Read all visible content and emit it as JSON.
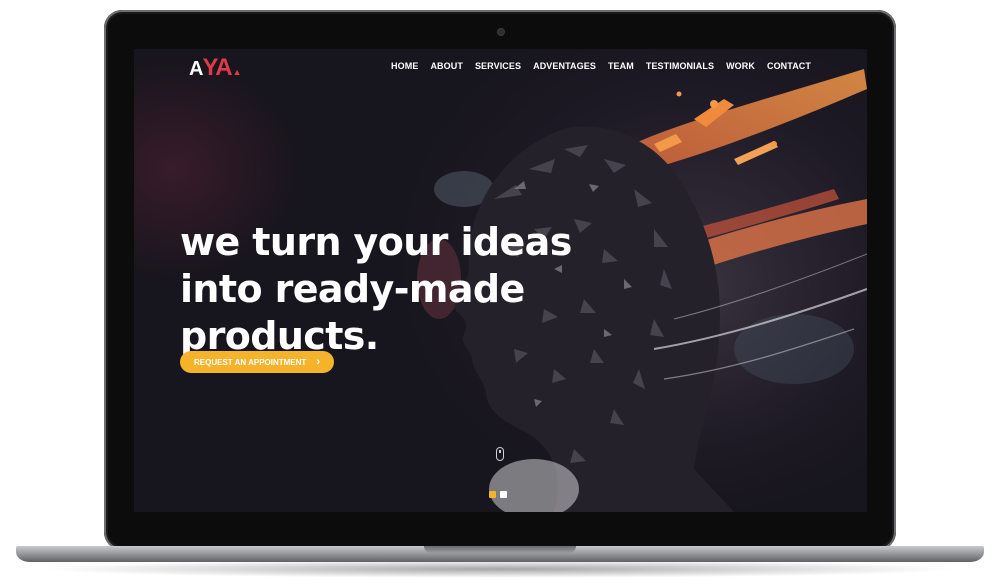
{
  "logo": {
    "letter_a": "A",
    "letters_ya": "YA",
    "mark": "▲"
  },
  "nav": {
    "items": [
      "HOME",
      "ABOUT",
      "SERVICES",
      "ADVENTAGES",
      "TEAM",
      "TESTIMONIALS",
      "WORK",
      "CONTACT"
    ]
  },
  "hero": {
    "headline_lines": [
      "we turn your ideas",
      "into ready-made",
      "products."
    ],
    "cta_label": "REQUEST AN APPOINTMENT",
    "cta_icon": "chevron-right-icon"
  },
  "slider": {
    "total": 2,
    "active": 1
  },
  "colors": {
    "accent": "#f4b32b",
    "logo_red": "#e23a4c",
    "background": "#1b1822",
    "dot_inactive": "#ffffff"
  }
}
